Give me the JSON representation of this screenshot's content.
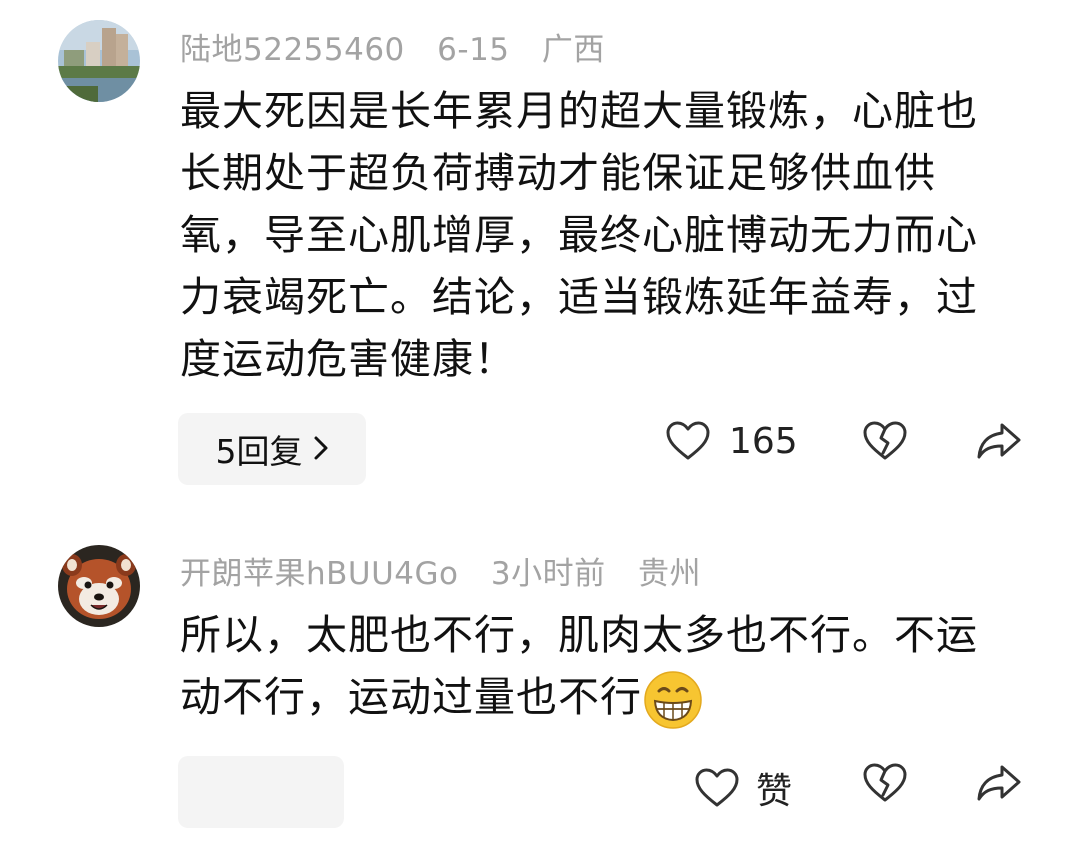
{
  "comments": [
    {
      "username": "陆地52255460",
      "date": "6-15",
      "location": "广西",
      "text": "最大死因是长年累月的超大量锻炼，心脏也长期处于超负荷搏动才能保证足够供血供氧，导至心肌增厚，最终心脏博动无力而心力衰竭死亡。结论，适当锻炼延年益寿，过度运动危害健康！",
      "replies_label": "5回复",
      "like_count": "165"
    },
    {
      "username": "开朗苹果hBUU4Go",
      "date": "3小时前",
      "location": "贵州",
      "text": "所以，太肥也不行，肌肉太多也不行。不运动不行，运动过量也不行",
      "emoji": "grinning-face-emoji",
      "like_label": "赞"
    }
  ],
  "icons": {
    "like": "heart-outline-icon",
    "dislike": "broken-heart-icon",
    "share": "share-arrow-icon",
    "chevron": "chevron-right-icon"
  }
}
